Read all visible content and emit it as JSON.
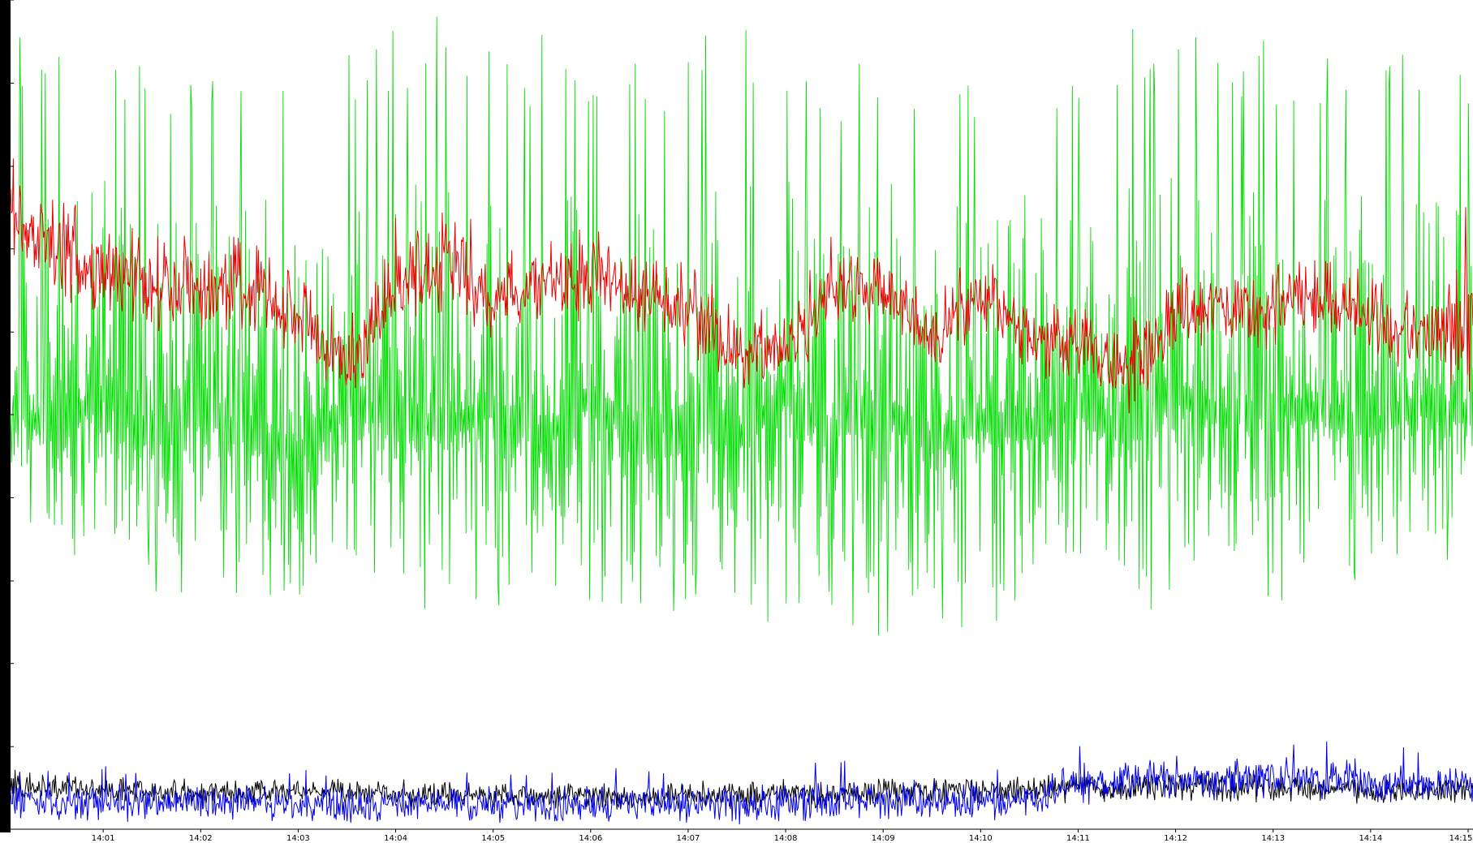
{
  "chart_data": {
    "type": "line",
    "title": "",
    "xlabel": "",
    "ylabel": "",
    "ylim": [
      0,
      1376
    ],
    "y_ticks": [
      "0",
      "137",
      "275",
      "412",
      "550",
      "688",
      "825",
      "963",
      "1100",
      "1238",
      "1376"
    ],
    "x_ticks": [
      "14:01",
      "14:02",
      "14:03",
      "14:04",
      "14:05",
      "14:06",
      "14:07",
      "14:08",
      "14:09",
      "14:10",
      "14:11",
      "14:12",
      "14:13",
      "14:14",
      "14:15"
    ],
    "x_range_minutes": [
      0.05,
      15.05
    ],
    "grid": false,
    "legend": "none",
    "series": [
      {
        "color": "#00dd00",
        "x": [
          0.05,
          0.5,
          1.0,
          1.5,
          2.0,
          2.5,
          3.0,
          3.5,
          4.0,
          4.5,
          5.0,
          5.5,
          6.0,
          6.5,
          7.0,
          7.5,
          8.0,
          8.5,
          9.0,
          9.5,
          10.0,
          10.5,
          11.0,
          11.5,
          12.0,
          12.5,
          13.0,
          13.5,
          14.0,
          14.5,
          15.05
        ],
        "values": [
          700,
          650,
          720,
          640,
          690,
          650,
          620,
          700,
          680,
          660,
          700,
          640,
          720,
          650,
          690,
          640,
          720,
          660,
          700,
          640,
          680,
          660,
          700,
          650,
          720,
          680,
          700,
          690,
          660,
          700,
          680
        ],
        "range_low": [
          560,
          430,
          470,
          380,
          400,
          380,
          330,
          360,
          400,
          330,
          380,
          310,
          330,
          350,
          360,
          310,
          330,
          360,
          300,
          330,
          310,
          300,
          330,
          300,
          380,
          360,
          380,
          340,
          400,
          410,
          420
        ],
        "range_high": [
          1340,
          1290,
          1320,
          1300,
          1260,
          1340,
          1320,
          1300,
          1340,
          1350,
          1310,
          1320,
          1290,
          1300,
          1320,
          1340,
          1330,
          1280,
          1330,
          1300,
          1270,
          1320,
          1300,
          1340,
          1330,
          1310,
          1320,
          1300,
          1310,
          1290,
          1320
        ]
      },
      {
        "color": "#ee0000",
        "x": [
          0.05,
          0.5,
          1.0,
          1.5,
          2.0,
          2.5,
          3.0,
          3.5,
          4.0,
          4.5,
          5.0,
          5.5,
          6.0,
          6.5,
          7.0,
          7.5,
          8.0,
          8.5,
          9.0,
          9.5,
          10.0,
          10.5,
          11.0,
          11.5,
          12.0,
          12.5,
          13.0,
          13.5,
          14.0,
          14.5,
          15.05
        ],
        "values": [
          1010,
          960,
          925,
          900,
          900,
          890,
          840,
          760,
          900,
          940,
          870,
          900,
          920,
          880,
          860,
          790,
          800,
          900,
          890,
          820,
          880,
          810,
          800,
          750,
          850,
          870,
          860,
          880,
          840,
          820,
          830
        ],
        "range_low": [
          920,
          880,
          840,
          820,
          810,
          800,
          760,
          690,
          820,
          860,
          800,
          830,
          850,
          810,
          780,
          720,
          730,
          830,
          820,
          750,
          810,
          740,
          720,
          680,
          780,
          800,
          790,
          800,
          770,
          750,
          760
        ],
        "range_high": [
          1120,
          1060,
          1010,
          990,
          990,
          980,
          930,
          850,
          1020,
          1100,
          950,
          980,
          1020,
          960,
          940,
          870,
          880,
          1000,
          980,
          900,
          960,
          890,
          870,
          840,
          940,
          960,
          950,
          960,
          920,
          900,
          1110
        ]
      },
      {
        "color": "#000000",
        "x": [
          0.05,
          0.5,
          1.0,
          1.5,
          2.0,
          2.5,
          3.0,
          3.5,
          4.0,
          4.5,
          5.0,
          5.5,
          6.0,
          6.5,
          7.0,
          7.5,
          8.0,
          8.5,
          9.0,
          9.5,
          10.0,
          10.5,
          11.0,
          11.5,
          12.0,
          12.5,
          13.0,
          13.5,
          14.0,
          14.5,
          15.05
        ],
        "values": [
          75,
          70,
          68,
          62,
          60,
          60,
          65,
          63,
          60,
          58,
          55,
          55,
          58,
          52,
          58,
          56,
          60,
          60,
          62,
          62,
          65,
          65,
          70,
          68,
          72,
          68,
          70,
          68,
          64,
          60,
          62
        ],
        "range_low": [
          45,
          42,
          40,
          36,
          34,
          35,
          38,
          36,
          34,
          32,
          30,
          30,
          32,
          28,
          32,
          30,
          34,
          34,
          35,
          35,
          38,
          38,
          40,
          38,
          42,
          38,
          40,
          38,
          36,
          34,
          36
        ],
        "range_high": [
          105,
          100,
          95,
          90,
          88,
          88,
          92,
          90,
          88,
          85,
          82,
          82,
          85,
          80,
          86,
          84,
          90,
          90,
          92,
          92,
          96,
          96,
          100,
          98,
          102,
          98,
          100,
          98,
          94,
          90,
          92
        ]
      },
      {
        "color": "#0000ee",
        "x": [
          0.05,
          0.5,
          1.0,
          1.5,
          2.0,
          2.5,
          3.0,
          3.5,
          4.0,
          4.5,
          5.0,
          5.5,
          6.0,
          6.5,
          7.0,
          7.5,
          8.0,
          8.5,
          9.0,
          9.5,
          10.0,
          10.5,
          11.0,
          11.5,
          12.0,
          12.5,
          13.0,
          13.5,
          14.0,
          14.5,
          15.05
        ],
        "values": [
          48,
          45,
          44,
          42,
          42,
          43,
          42,
          41,
          42,
          42,
          40,
          42,
          43,
          42,
          44,
          44,
          45,
          46,
          46,
          46,
          48,
          48,
          78,
          82,
          86,
          84,
          82,
          82,
          78,
          70,
          72
        ],
        "range_low": [
          28,
          26,
          25,
          24,
          24,
          25,
          24,
          23,
          24,
          24,
          22,
          24,
          25,
          24,
          26,
          26,
          27,
          28,
          28,
          28,
          30,
          30,
          58,
          62,
          66,
          64,
          62,
          62,
          58,
          50,
          52
        ],
        "range_high": [
          95,
          100,
          105,
          100,
          98,
          102,
          100,
          98,
          100,
          102,
          98,
          100,
          104,
          102,
          106,
          108,
          112,
          118,
          115,
          112,
          110,
          108,
          150,
          148,
          150,
          150,
          148,
          148,
          146,
          140,
          130
        ]
      }
    ]
  }
}
